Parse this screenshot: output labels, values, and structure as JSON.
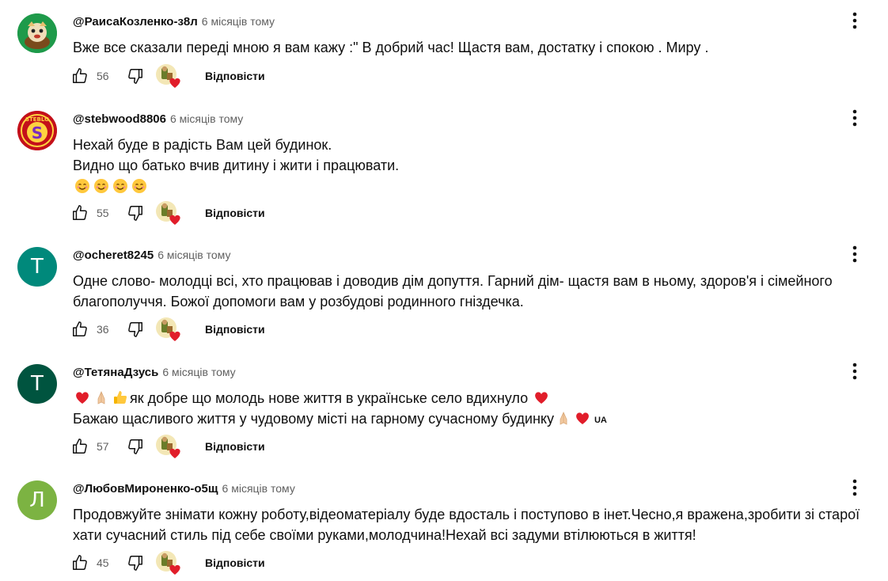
{
  "comments": [
    {
      "author": "@РаисаКозленко-з8л",
      "time": "6 місяців тому",
      "lines": [
        "Вже все сказали переді мною я вам кажу :\" В добрий час! Щастя вам, достатку і спокою . Миру ."
      ],
      "likes": "56",
      "reply_label": "Відповісти",
      "avatar_type": "image",
      "avatar_icon": "cartoon-character-avatar",
      "avatar_bg": "#1e9a4a"
    },
    {
      "author": "@stebwood8806",
      "time": "6 місяців тому",
      "lines": [
        "Нехай буде в радість Вам цей будинок.",
        "Видно що батько вчив дитину і жити і працювати."
      ],
      "emoji_count": 4,
      "emoji_name": "smiling-face-emoji",
      "likes": "55",
      "reply_label": "Відповісти",
      "avatar_type": "image",
      "avatar_icon": "steblo-logo-avatar",
      "avatar_text_top": "STEBLO",
      "avatar_text_mid": "S",
      "avatar_bg": "#c4101a"
    },
    {
      "author": "@ocheret8245",
      "time": "6 місяців тому",
      "lines": [
        "Одне слово- молодці всі, хто працював і доводив дім допуття. Гарний дім- щастя вам в ньому, здоров'я і сімейного",
        "благополуччя. Божої допомоги вам у розбудові родинного гніздечка."
      ],
      "likes": "36",
      "reply_label": "Відповісти",
      "avatar_type": "letter",
      "avatar_letter": "Т",
      "avatar_bg": "#00897b"
    },
    {
      "author": "@ТетянаДзусь",
      "time": "6 місяців тому",
      "line1_text": "як добре що молодь нове життя в українське село вдихнуло",
      "line2_text": "Бажаю щасливого життя у чудовому місті на гарному сучасному будинку",
      "ua_tag": "UA",
      "likes": "57",
      "reply_label": "Відповісти",
      "avatar_type": "letter",
      "avatar_letter": "Т",
      "avatar_bg": "#00543f"
    },
    {
      "author": "@ЛюбовМироненко-о5щ",
      "time": "6 місяців тому",
      "lines": [
        "Продовжуйте знімати кожну роботу,відеоматеріалу буде вдосталь і поступово в інет.Чесно,я вражена,зробити зі старої",
        "хати сучасний стиль під себе своїми руками,молодчина!Нехай всі задуми втілюються в життя!"
      ],
      "likes": "45",
      "reply_label": "Відповісти",
      "avatar_type": "letter",
      "avatar_letter": "Л",
      "avatar_bg": "#7cb342"
    }
  ],
  "icons": {
    "like": "thumb-up-icon",
    "dislike": "thumb-down-icon",
    "creator_heart": "creator-heart-icon",
    "menu": "more-vertical-icon"
  },
  "colors": {
    "text": "#0f0f0f",
    "secondary": "#606060",
    "heart": "#e11d2a"
  }
}
